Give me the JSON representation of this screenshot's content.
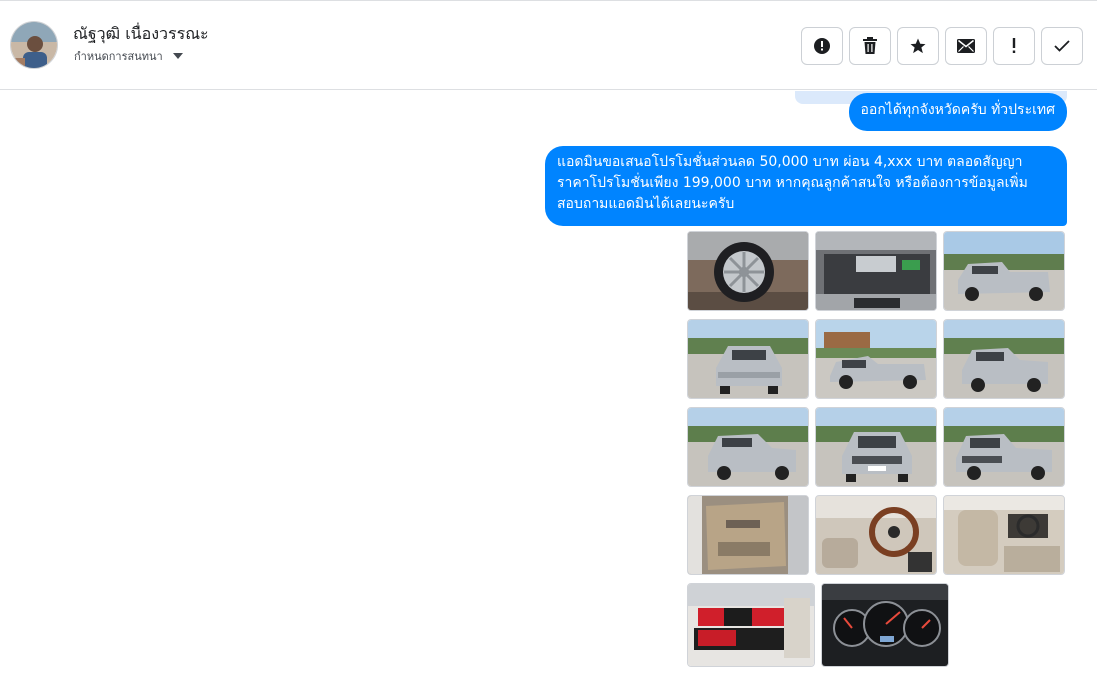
{
  "header": {
    "contact_name": "ณัฐวุฒิ เนื่องวรรณะ",
    "conversation_settings_label": "กำหนดการสนทนา"
  },
  "actions": [
    {
      "name": "mark-spam-button",
      "icon": "alert-circle-icon"
    },
    {
      "name": "delete-button",
      "icon": "trash-icon"
    },
    {
      "name": "star-button",
      "icon": "star-icon"
    },
    {
      "name": "mark-unread-button",
      "icon": "envelope-icon"
    },
    {
      "name": "mark-important-button",
      "icon": "exclamation-icon"
    },
    {
      "name": "mark-done-button",
      "icon": "check-icon"
    }
  ],
  "messages": {
    "msg1": "ออกได้ทุกจังหวัดครับ ทั่วประเทศ",
    "msg2": "แอดมินขอเสนอโปรโมชั่นส่วนลด 50,000 บาท ผ่อน 4,xxx บาท ตลอดสัญญา\nราคาโปรโมชั่นเพียง 199,000 บาท หากคุณลูกค้าสนใจ หรือต้องการข้อมูลเพิ่ม\nสอบถามแอดมินได้เลยนะครับ"
  },
  "attachments": [
    {
      "name": "photo-wheel",
      "subject": "wheel"
    },
    {
      "name": "photo-engine",
      "subject": "engine"
    },
    {
      "name": "photo-front-three-quarter",
      "subject": "truck-front"
    },
    {
      "name": "photo-rear",
      "subject": "truck-rear"
    },
    {
      "name": "photo-side",
      "subject": "truck-side"
    },
    {
      "name": "photo-rear-three-quarter",
      "subject": "truck-rear"
    },
    {
      "name": "photo-rear-left",
      "subject": "truck-rear"
    },
    {
      "name": "photo-front",
      "subject": "truck-front"
    },
    {
      "name": "photo-front-angle",
      "subject": "truck-front"
    },
    {
      "name": "photo-door-panel",
      "subject": "door"
    },
    {
      "name": "photo-steering",
      "subject": "interior"
    },
    {
      "name": "photo-seats",
      "subject": "interior"
    },
    {
      "name": "photo-rear-seat",
      "subject": "seat"
    },
    {
      "name": "photo-dashboard",
      "subject": "gauges"
    }
  ],
  "colors": {
    "bubble": "#0084ff",
    "truck": "#b9bec4"
  }
}
